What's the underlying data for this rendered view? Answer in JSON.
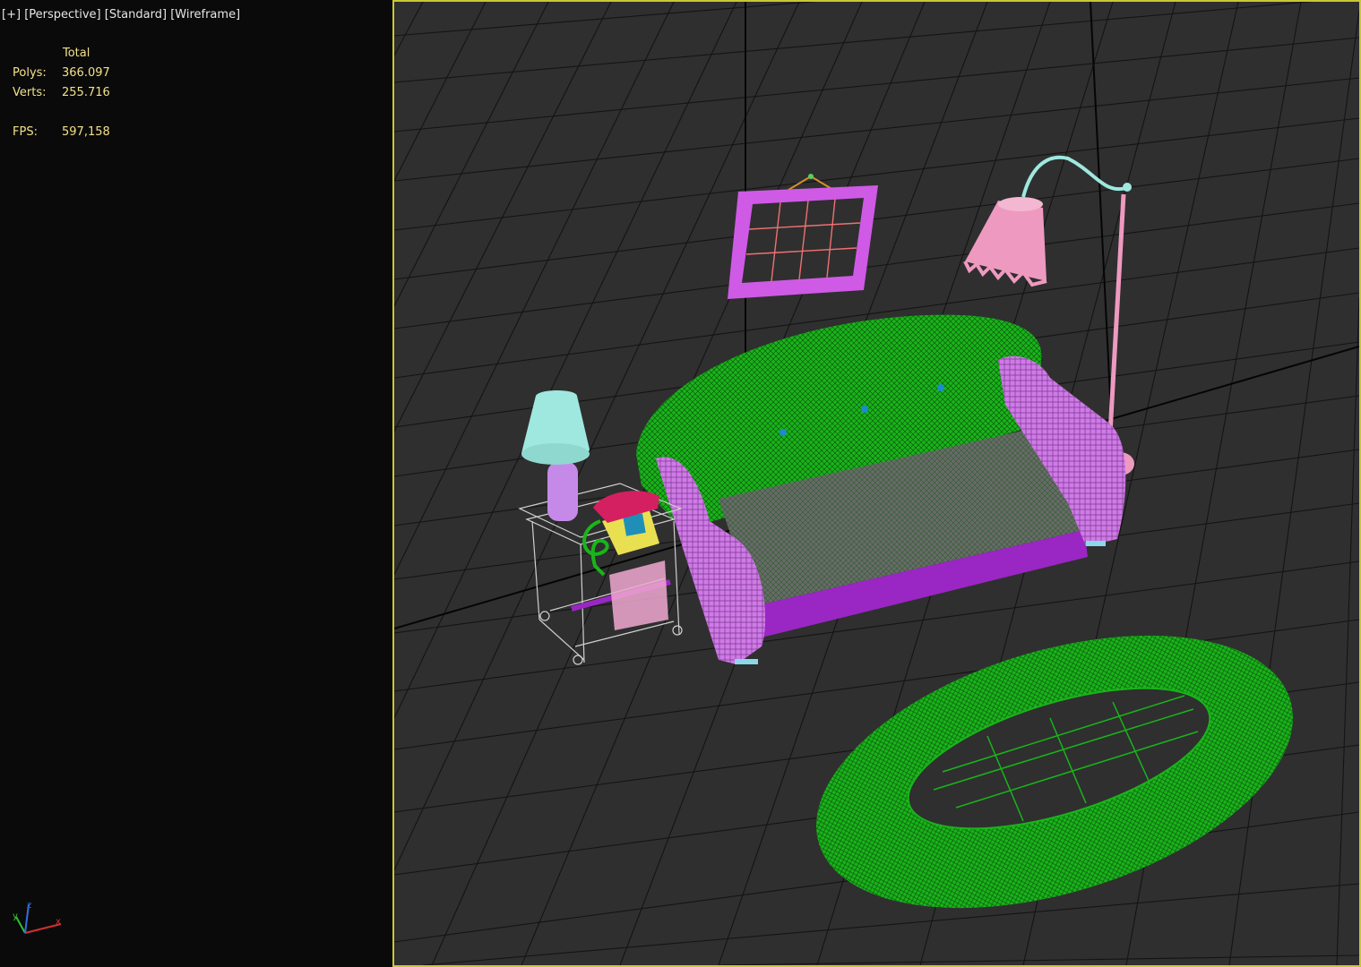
{
  "viewport_label": {
    "plus": "[+]",
    "view": "[Perspective]",
    "shading": "[Standard]",
    "mode": "[Wireframe]"
  },
  "stats": {
    "header": "Total",
    "polys_label": "Polys:",
    "polys_value": "366.097",
    "verts_label": "Verts:",
    "verts_value": "255.716",
    "fps_label": "FPS:",
    "fps_value": "597,158"
  },
  "axis_gizmo": {
    "x": "x",
    "y": "y",
    "z": "z"
  },
  "colors": {
    "viewport_border": "#c8c832",
    "stats_text": "#f2e08a",
    "sofa_green": "#19b51a",
    "sofa_magenta": "#d07ae8",
    "frame_magenta": "#cf5ae6",
    "lamp_pink": "#ee9ac0",
    "lamp_cyan": "#9ee8e0"
  }
}
